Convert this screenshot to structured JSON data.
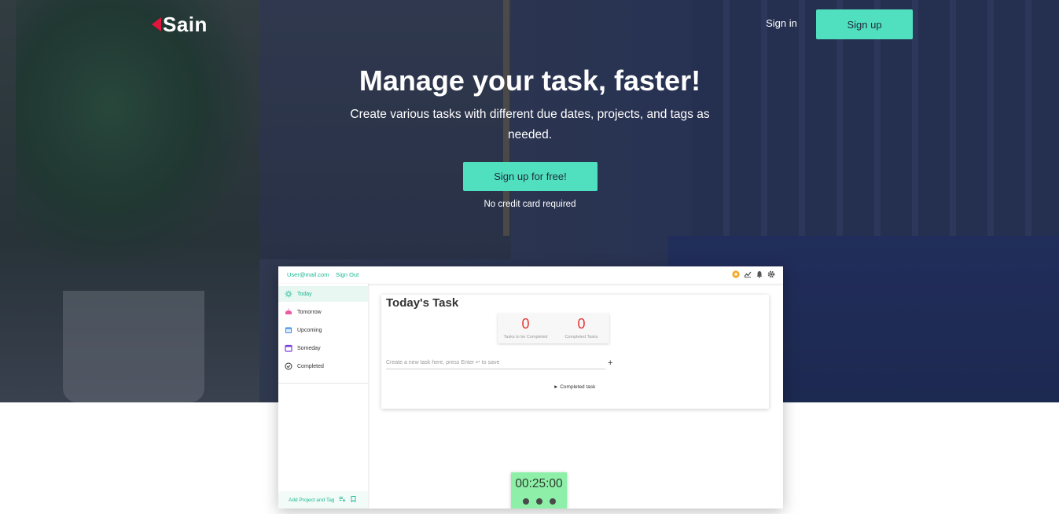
{
  "brand": {
    "name": "Sain",
    "accent": "#50e0c0",
    "logo_color": "#e0163a"
  },
  "nav": {
    "signin_label": "Sign in",
    "signup_label": "Sign up"
  },
  "hero": {
    "headline": "Manage your task, faster!",
    "subline": "Create various tasks with different due dates, projects, and tags as needed.",
    "cta_label": "Sign up for free!",
    "note": "No credit card required"
  },
  "app": {
    "top": {
      "email": "User@mail.com",
      "signout": "Sign Out",
      "icons": [
        "star-badge-icon",
        "chart-icon",
        "bell-icon",
        "gear-icon"
      ]
    },
    "sidebar": {
      "items": [
        {
          "label": "Today",
          "icon": "sun-icon",
          "active": true
        },
        {
          "label": "Tomorrow",
          "icon": "sunrise-icon"
        },
        {
          "label": "Upcoming",
          "icon": "calendar-icon"
        },
        {
          "label": "Someday",
          "icon": "calendar-outline-icon"
        },
        {
          "label": "Completed",
          "icon": "check-circle-icon"
        }
      ],
      "footer_label": "Add Project and Tag",
      "footer_icons": [
        "playlist-add-icon",
        "bookmark-icon"
      ]
    },
    "main": {
      "title": "Today's Task",
      "stats": [
        {
          "value": "0",
          "label": "Tasks to be Completed"
        },
        {
          "value": "0",
          "label": "Completed Tasks"
        }
      ],
      "new_task_placeholder": "Create a new task here, press Enter ↵ to save",
      "add_icon": "plus-icon",
      "completed_toggle": "► Completed task"
    },
    "timer": {
      "time": "00:25:00",
      "controls": [
        "play-icon",
        "pause-icon",
        "stop-icon"
      ]
    }
  }
}
